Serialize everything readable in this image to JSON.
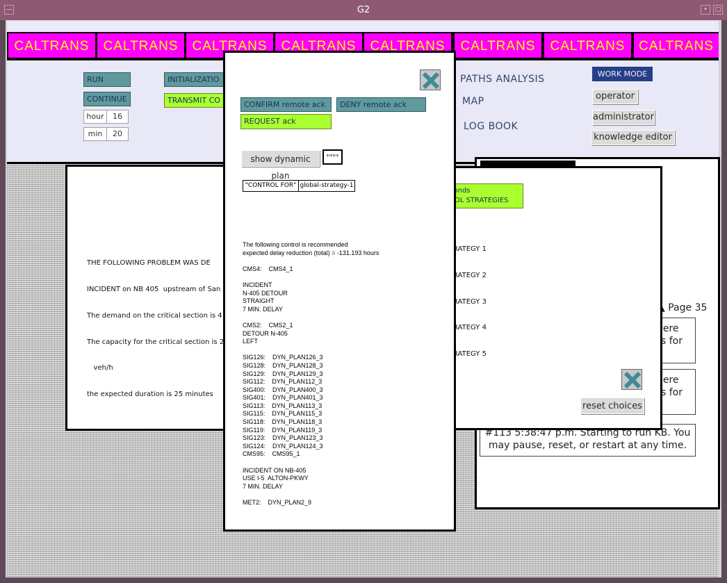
{
  "window": {
    "title": "G2"
  },
  "banner": {
    "cells": [
      "CALTRANS",
      "CALTRANS",
      "CALTRANS",
      "CALTRANS",
      "CALTRANS",
      "CALTRANS",
      "CALTRANS",
      "CALTRANS"
    ]
  },
  "controls": {
    "run": "RUN",
    "continue": "CONTINUE",
    "initialization": "INITIALIZATIO",
    "transmit": "TRANSMIT CO",
    "hour_label": "hour",
    "hour_value": "16",
    "min_label": "min",
    "min_value": "20"
  },
  "menu": {
    "paths_analysis": "PATHS ANALYSIS",
    "map": "MAP",
    "log_book": "LOG BOOK"
  },
  "work_mode": {
    "title": "WORK MODE",
    "operator": "operator",
    "administrator": "administrator",
    "knowledge_editor": "knowledge editor"
  },
  "problem": {
    "lines": [
      "THE FOLLOWING PROBLEM WAS DE",
      "INCIDENT on NB 405  upstream of San",
      "The demand on the critical section is 4",
      "The capacity for the critical section is 2",
      "   veh/h",
      "the expected duration is 25 minutes"
    ]
  },
  "strategies": {
    "header_line1": "conds",
    "header_line2": "ROL STRATEGIES",
    "items": [
      "RATEGY 1",
      "RATEGY 2",
      "RATEGY 3",
      "RATEGY 4",
      "RATEGY 5"
    ],
    "reset": "reset choices"
  },
  "messages": {
    "page_label": "Page 35",
    "msg1_tail": [
      "were",
      "es for"
    ],
    "msg2_tail": [
      "were",
      "es for"
    ],
    "msg3_line1": "#113    5:38:47 p.m.    Starting to run KB. You",
    "msg3_line2": "may pause, reset, or restart at any time."
  },
  "control": {
    "confirm": "CONFIRM remote ack",
    "deny": "DENY remote ack",
    "request": "REQUEST ack",
    "show_plan": "show dynamic plan",
    "stars": "****",
    "control_for_label": "\"CONTROL FOR\"",
    "control_for_value": "global-strategy-1",
    "text": "The following control is recommended\nexpected delay reduction (total) = -131.193 hours\n\nCMS4:    CMS4_1\n\nINCIDENT\nN-405 DETOUR\nSTRAIGHT\n7 MIN. DELAY\n\nCMS2:    CMS2_1\nDETOUR N-405\nLEFT\n\nSIG126:    DYN_PLAN126_3\nSIG128:    DYN_PLAN128_3\nSIG129:    DYN_PLAN129_3\nSIG112:    DYN_PLAN112_3\nSIG400:    DYN_PLAN400_3\nSIG401:    DYN_PLAN401_3\nSIG113:    DYN_PLAN113_3\nSIG115:    DYN_PLAN115_3\nSIG118:    DYN_PLAN118_3\nSIG119:    DYN_PLAN119_3\nSIG123:    DYN_PLAN123_3\nSIG124:    DYN_PLAN124_3\nCMS95:    CMS95_1\n\nINCIDENT ON NB-405\nUSE I-5  ALTON-PKWY\n7 MIN. DELAY\n\nMET2:    DYN_PLAN2_9"
  }
}
